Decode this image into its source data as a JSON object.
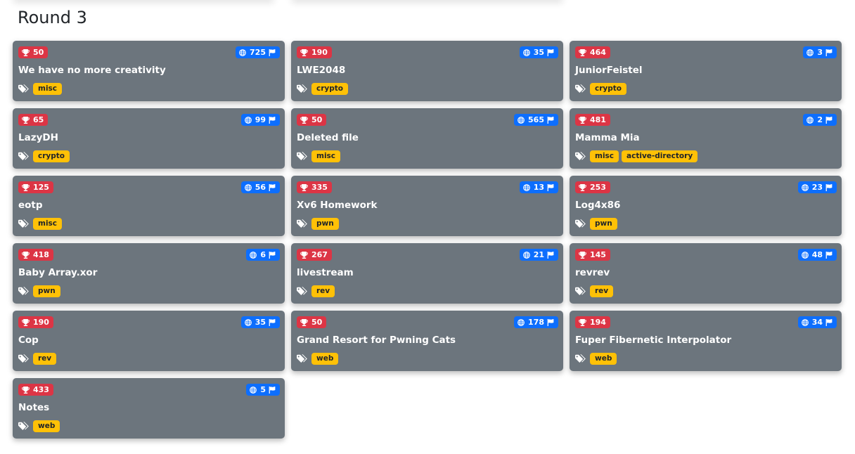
{
  "page": {
    "title": "Round 3"
  },
  "colors": {
    "card": "#6c757d",
    "points_badge": "#dc3545",
    "solves_badge": "#0d6efd",
    "tag": "#ffc107"
  },
  "icons": {
    "points": "trophy-icon",
    "solves": "globe-icon",
    "flag": "flag-icon",
    "tags": "tags-icon"
  },
  "challenges": [
    {
      "points": "50",
      "solves": "725",
      "name": "We have no more creativity",
      "tags": [
        "misc"
      ]
    },
    {
      "points": "190",
      "solves": "35",
      "name": "LWE2048",
      "tags": [
        "crypto"
      ]
    },
    {
      "points": "464",
      "solves": "3",
      "name": "JuniorFeistel",
      "tags": [
        "crypto"
      ]
    },
    {
      "points": "65",
      "solves": "99",
      "name": "LazyDH",
      "tags": [
        "crypto"
      ]
    },
    {
      "points": "50",
      "solves": "565",
      "name": "Deleted file",
      "tags": [
        "misc"
      ]
    },
    {
      "points": "481",
      "solves": "2",
      "name": "Mamma Mia",
      "tags": [
        "misc",
        "active-directory"
      ]
    },
    {
      "points": "125",
      "solves": "56",
      "name": "eotp",
      "tags": [
        "misc"
      ]
    },
    {
      "points": "335",
      "solves": "13",
      "name": "Xv6 Homework",
      "tags": [
        "pwn"
      ]
    },
    {
      "points": "253",
      "solves": "23",
      "name": "Log4x86",
      "tags": [
        "pwn"
      ]
    },
    {
      "points": "418",
      "solves": "6",
      "name": "Baby Array.xor",
      "tags": [
        "pwn"
      ]
    },
    {
      "points": "267",
      "solves": "21",
      "name": "livestream",
      "tags": [
        "rev"
      ]
    },
    {
      "points": "145",
      "solves": "48",
      "name": "revrev",
      "tags": [
        "rev"
      ]
    },
    {
      "points": "190",
      "solves": "35",
      "name": "Cop",
      "tags": [
        "rev"
      ]
    },
    {
      "points": "50",
      "solves": "178",
      "name": "Grand Resort for Pwning Cats",
      "tags": [
        "web"
      ]
    },
    {
      "points": "194",
      "solves": "34",
      "name": "Fuper Fibernetic Interpolator",
      "tags": [
        "web"
      ]
    },
    {
      "points": "433",
      "solves": "5",
      "name": "Notes",
      "tags": [
        "web"
      ]
    }
  ]
}
